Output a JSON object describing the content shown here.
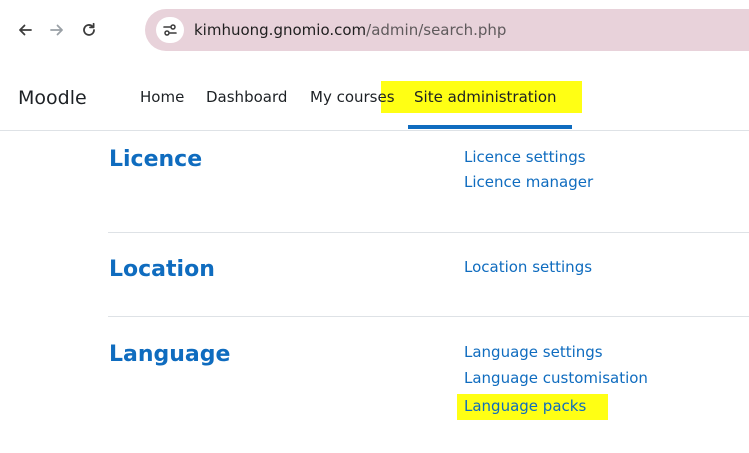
{
  "browser": {
    "url_host": "kimhuong.gnomio.com",
    "url_path": "/admin/search.php",
    "colors": {
      "address_bar_bg": "#e8d2da",
      "icon": "#3c3c3c",
      "icon_disabled": "#9aa0a6"
    },
    "icons": [
      "back-arrow-icon",
      "forward-arrow-icon",
      "reload-icon",
      "site-info-icon"
    ]
  },
  "header": {
    "brand": "Moodle",
    "nav": [
      {
        "label": "Home",
        "active": false
      },
      {
        "label": "Dashboard",
        "active": false
      },
      {
        "label": "My courses",
        "active": false
      },
      {
        "label": "Site administration",
        "active": true
      }
    ],
    "accent_color": "#0f6cbf",
    "highlight_color": "#ffff14"
  },
  "categories": [
    {
      "heading": "Licence",
      "links": [
        "Licence settings",
        "Licence manager"
      ]
    },
    {
      "heading": "Location",
      "links": [
        "Location settings"
      ]
    },
    {
      "heading": "Language",
      "links": [
        "Language settings",
        "Language customisation",
        "Language packs"
      ],
      "highlighted_link": "Language packs"
    }
  ]
}
